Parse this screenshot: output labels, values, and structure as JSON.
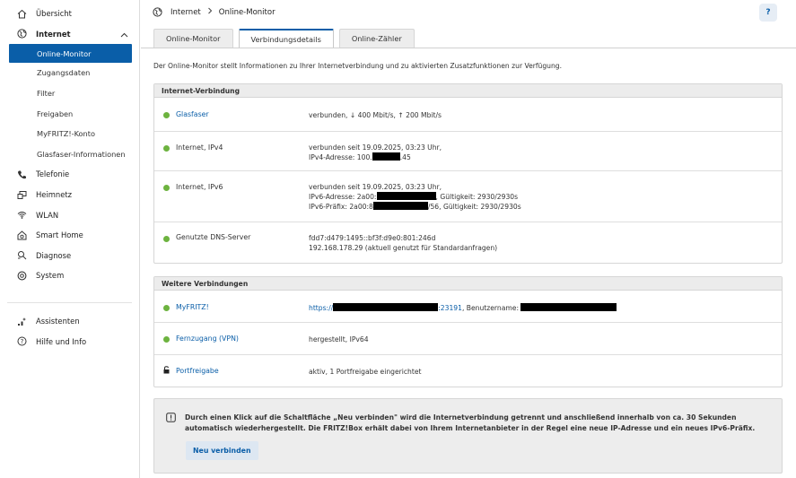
{
  "sidebar": {
    "items": [
      {
        "label": "Übersicht",
        "icon": "home-icon"
      },
      {
        "label": "Internet",
        "icon": "globe-icon",
        "expanded": true
      },
      {
        "label": "Telefonie",
        "icon": "phone-icon"
      },
      {
        "label": "Heimnetz",
        "icon": "network-icon"
      },
      {
        "label": "WLAN",
        "icon": "wifi-icon"
      },
      {
        "label": "Smart Home",
        "icon": "smarthome-icon"
      },
      {
        "label": "Diagnose",
        "icon": "diagnose-icon"
      },
      {
        "label": "System",
        "icon": "system-icon"
      }
    ],
    "internet_sub": [
      "Online-Monitor",
      "Zugangsdaten",
      "Filter",
      "Freigaben",
      "MyFRITZ!-Konto",
      "Glasfaser-Informationen"
    ],
    "bottom_items": [
      {
        "label": "Assistenten",
        "icon": "assistant-icon"
      },
      {
        "label": "Hilfe und Info",
        "icon": "help-icon"
      }
    ]
  },
  "breadcrumb": {
    "root": "Internet",
    "current": "Online-Monitor"
  },
  "help_label": "?",
  "tabs": [
    "Online-Monitor",
    "Verbindungsdetails",
    "Online-Zähler"
  ],
  "intro": "Der Online-Monitor stellt Informationen zu Ihrer Internetverbindung und zu aktivierten Zusatzfunktionen zur Verfügung.",
  "internet_panel": {
    "title": "Internet-Verbindung",
    "rows": [
      {
        "label": "Glasfaser",
        "line1": "verbunden, ↓ 400 Mbit/s, ↑ 200 Mbit/s"
      },
      {
        "label": "Internet, IPv4",
        "line1": "verbunden seit 19.09.2025, 03:23 Uhr,",
        "line2_a": "IPv4-Adresse: 100.",
        "line2_b": ".45"
      },
      {
        "label": "Internet, IPv6",
        "line1": "verbunden seit 19.09.2025, 03:23 Uhr,",
        "line2_a": "IPv6-Adresse: 2a00:",
        "line2_b": ", Gültigkeit: 2930/2930s",
        "line3_a": "IPv6-Präfix: 2a00:8",
        "line3_b": "/56, Gültigkeit: 2930/2930s"
      },
      {
        "label": "Genutzte DNS-Server",
        "line1": "fdd7:d479:1495::bf3f:d9e0:801:246d",
        "line2": "192.168.178.29 (aktuell genutzt für Standardanfragen)"
      }
    ]
  },
  "further_panel": {
    "title": "Weitere Verbindungen",
    "rows": [
      {
        "label": "MyFRITZ!",
        "link_a": "https://",
        "link_b": ":23191",
        "text_b": ", Benutzername: "
      },
      {
        "label": "Fernzugang (VPN)",
        "value": "hergestellt, IPv64"
      },
      {
        "label": "Portfreigabe",
        "value": "aktiv, 1 Portfreigabe eingerichtet"
      }
    ]
  },
  "note": {
    "text": "Durch einen Klick auf die Schaltfläche „Neu verbinden\" wird die Internetverbindung getrennt und anschließend innerhalb von ca. 30 Sekunden automatisch wiederhergestellt. Die FRITZ!Box erhält dabei von Ihrem Internetanbieter in der Regel eine neue IP-Adresse und ein neues IPv6-Präfix.",
    "button": "Neu verbinden"
  },
  "colors": {
    "accent": "#0a5ea8",
    "status_ok": "#6db33f"
  }
}
